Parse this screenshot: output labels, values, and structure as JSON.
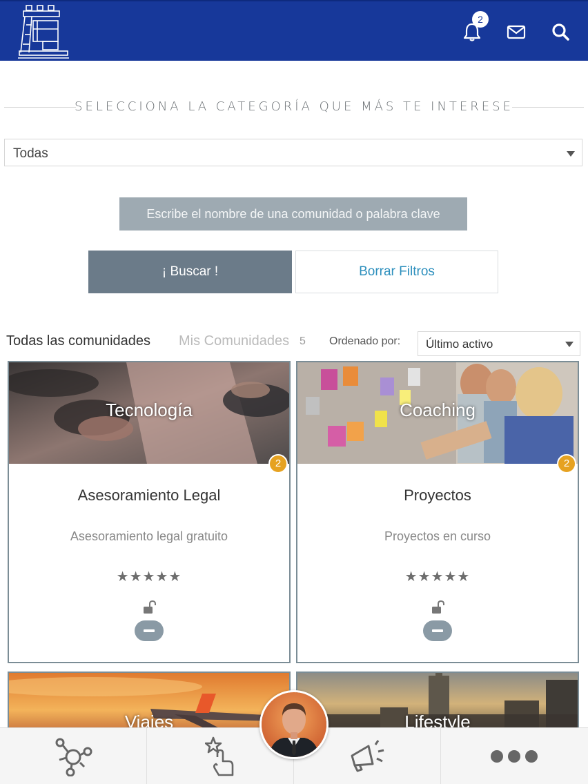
{
  "header": {
    "logo_icon": "tower-logo-icon",
    "notification_count": "2",
    "icons": [
      "bell-icon",
      "mail-icon",
      "search-icon"
    ],
    "background_color": "#17389a"
  },
  "filters": {
    "heading": "SELECCIONA LA CATEGORÍA QUE MÁS TE INTERESE",
    "category_selected": "Todas",
    "keyword_placeholder": "Escribe el nombre de una comunidad o palabra clave",
    "search_button": "¡ Buscar !",
    "clear_button": "Borrar Filtros"
  },
  "tabs": {
    "all": "Todas las comunidades",
    "mine": "Mis Comunidades",
    "mine_count": "5",
    "sort_label": "Ordenado por:",
    "sort_selected": "Último activo"
  },
  "cards": [
    {
      "category": "Tecnología",
      "badge": "2",
      "title": "Asesoramiento Legal",
      "description": "Asesoramiento legal gratuito",
      "stars": "★★★★★",
      "rating": 5
    },
    {
      "category": "Coaching",
      "badge": "2",
      "title": "Proyectos",
      "description": "Proyectos en curso",
      "stars": "★★★★★",
      "rating": 5
    },
    {
      "category": "Viajes"
    },
    {
      "category": "Lifestyle"
    }
  ],
  "bottom_nav": {
    "items": [
      "network-icon",
      "touch-hand-icon",
      "megaphone-icon",
      "more-dots-icon"
    ],
    "avatar": "profile-avatar"
  },
  "colors": {
    "accent_blue": "#17389a",
    "badge_orange": "#e6a221",
    "button_dark": "#6b7b89",
    "link_blue": "#2d8fbd"
  }
}
